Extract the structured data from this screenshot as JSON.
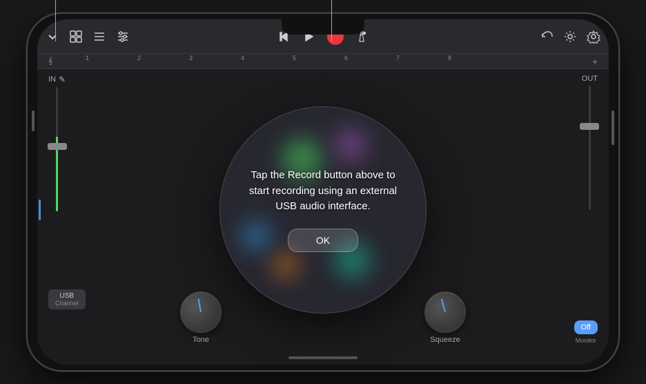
{
  "toolbar": {
    "icons": {
      "dropdown": "▼",
      "grid": "⊞",
      "list": "≡",
      "sliders": "⊟",
      "skip_back": "⏮",
      "play": "▶",
      "record": "●",
      "metronome": "🎵",
      "undo": "↩",
      "brightness": "☀",
      "settings": "⚙"
    }
  },
  "ruler": {
    "marks": [
      "1",
      "2",
      "3",
      "4",
      "5",
      "6",
      "7",
      "8"
    ],
    "plus": "+"
  },
  "track": {
    "in_label": "IN",
    "out_label": "OUT"
  },
  "usb_button": {
    "label": "USB",
    "sublabel": "Channel"
  },
  "knobs": [
    {
      "label": "Tone",
      "rotation": -10
    },
    {
      "label": "Squeeze",
      "rotation": -15
    }
  ],
  "monitor": {
    "off_label": "Off",
    "label": "Monitor"
  },
  "dialog": {
    "message": "Tap the Record button above to start recording using an external USB audio interface.",
    "ok_label": "OK"
  }
}
